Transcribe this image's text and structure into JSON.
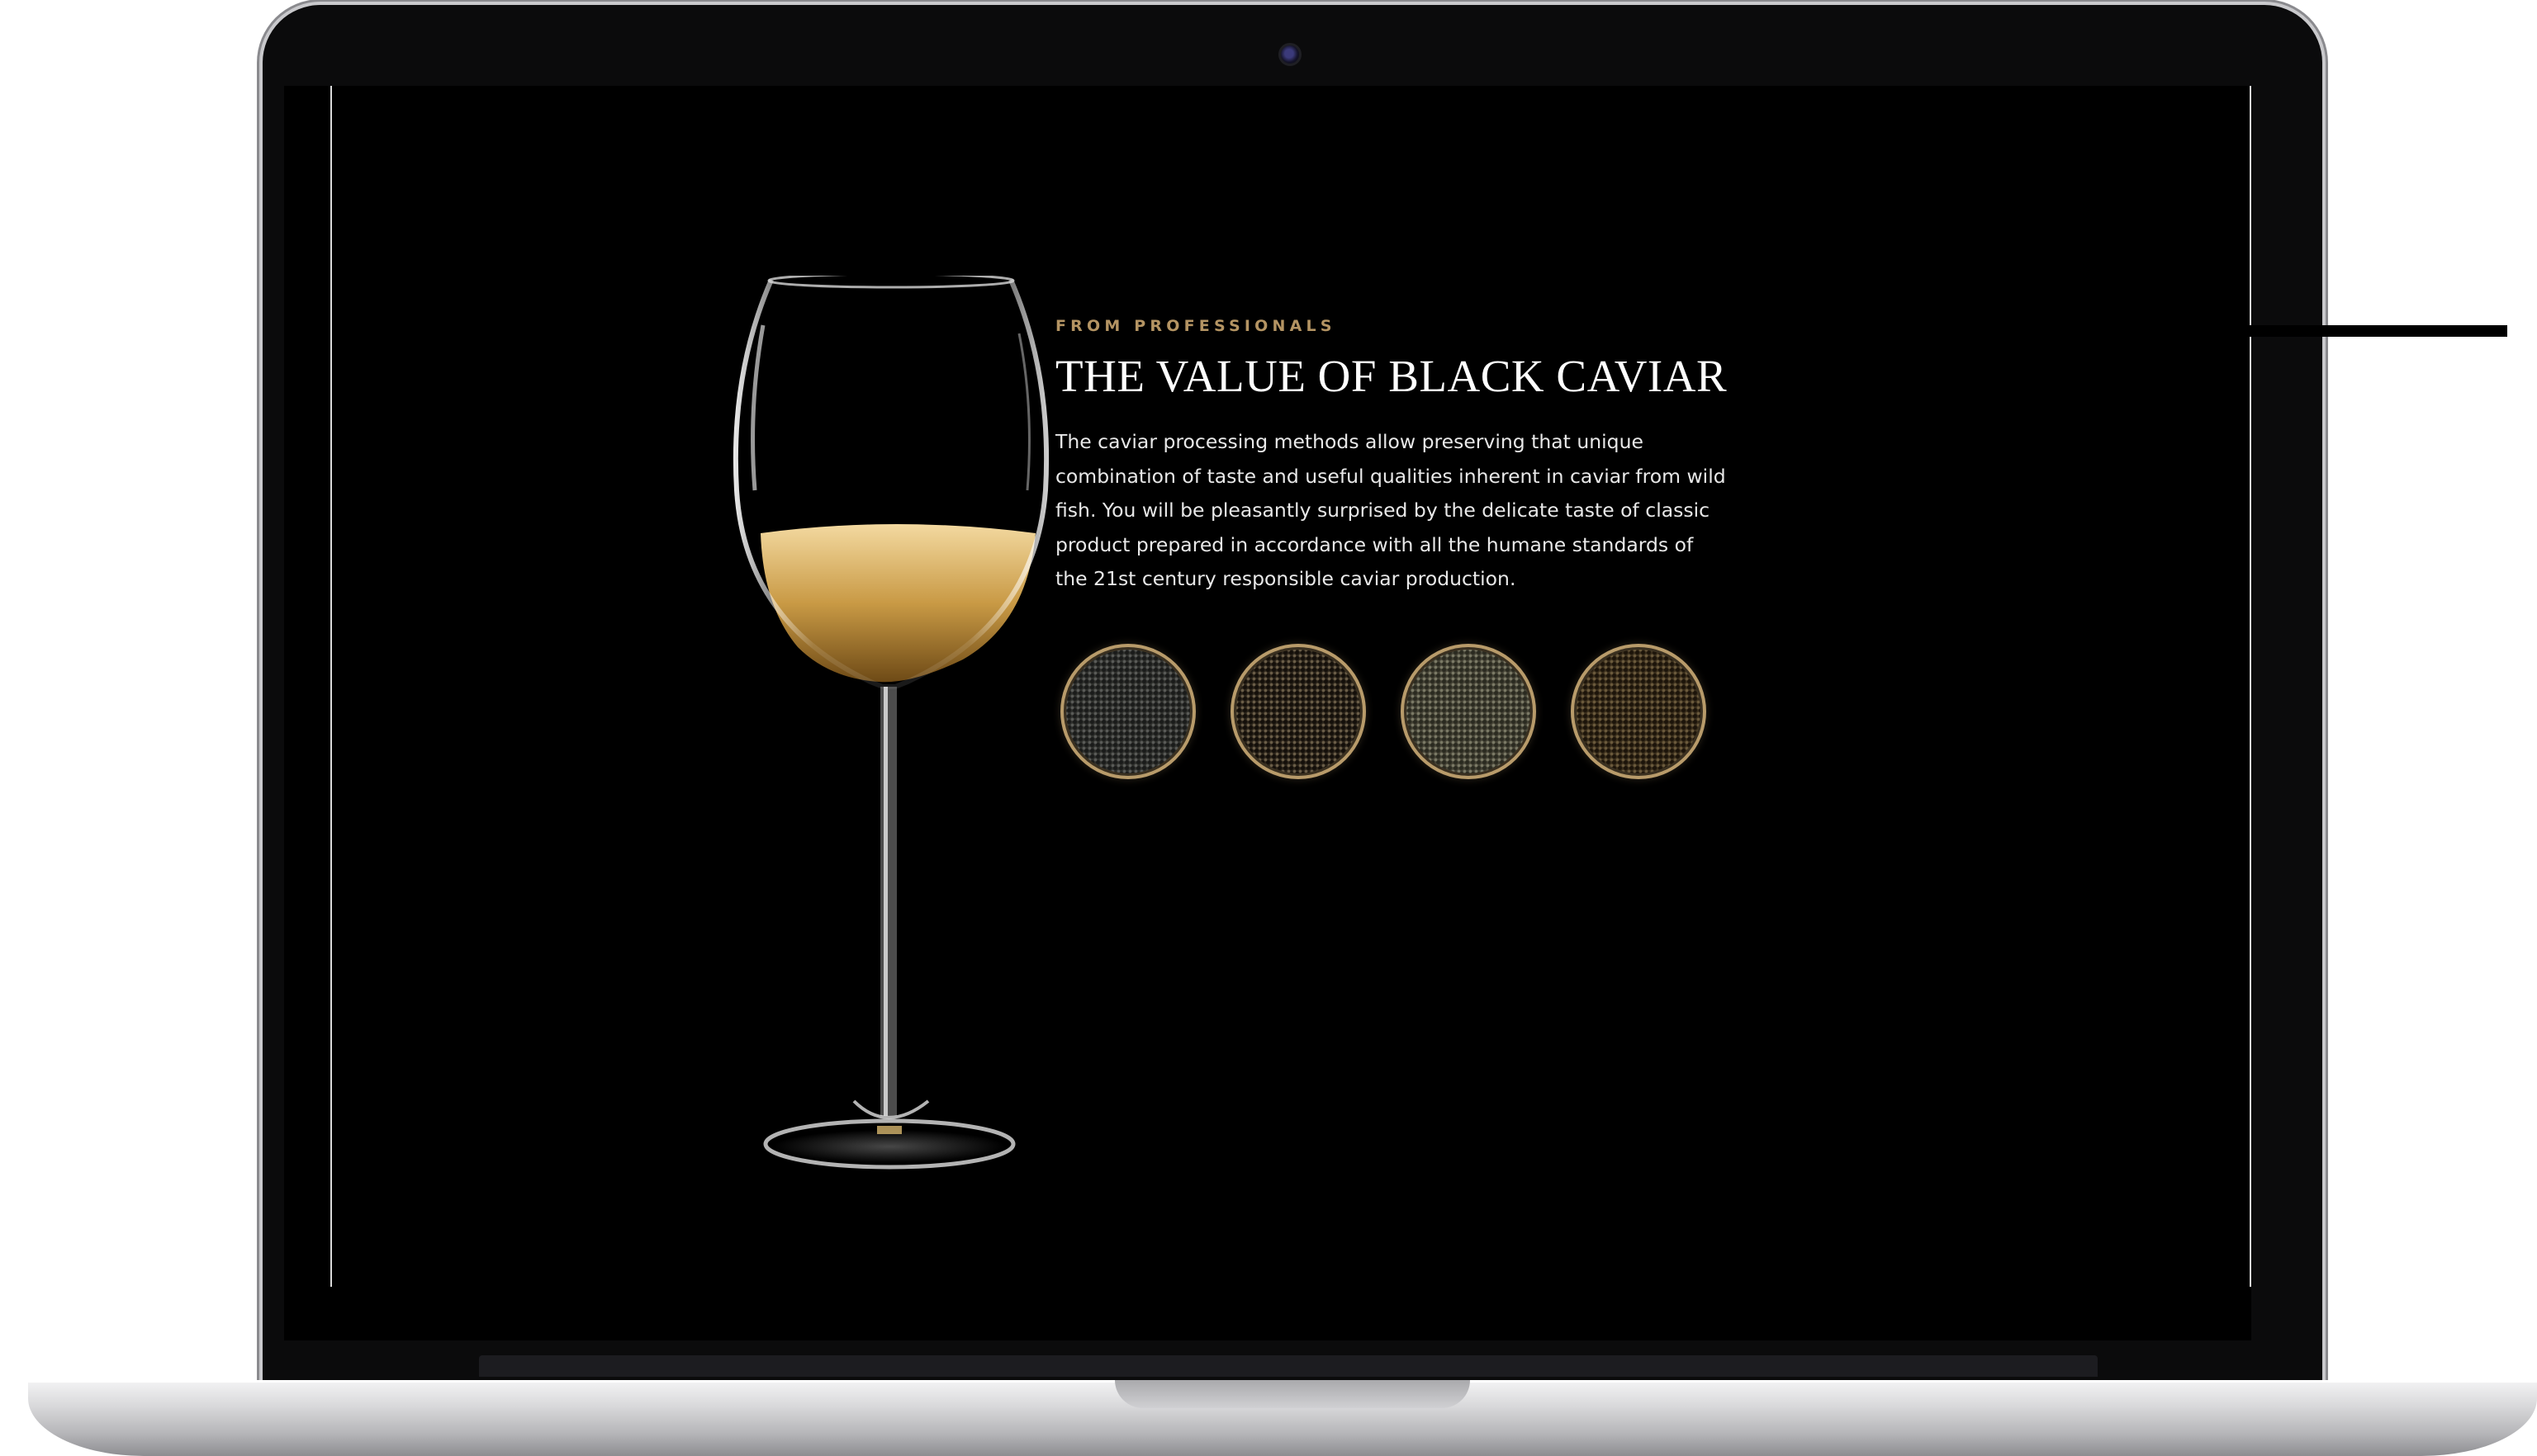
{
  "hero": {
    "eyebrow": "FROM PROFESSIONALS",
    "title": "THE VALUE OF BLACK CAVIAR",
    "description": "The caviar processing methods allow preserving that unique combination of taste and useful qualities inherent in caviar from wild fish. You will be pleasantly surprised by the delicate taste of classic product prepared in accordance with all the humane standards of the 21st century responsible caviar production."
  },
  "colors": {
    "accent": "#b49463",
    "background": "#000000",
    "text": "#ffffff"
  },
  "caviar_tins": [
    {
      "name": "caviar-tin-1"
    },
    {
      "name": "caviar-tin-2"
    },
    {
      "name": "caviar-tin-3"
    },
    {
      "name": "caviar-tin-4"
    }
  ]
}
